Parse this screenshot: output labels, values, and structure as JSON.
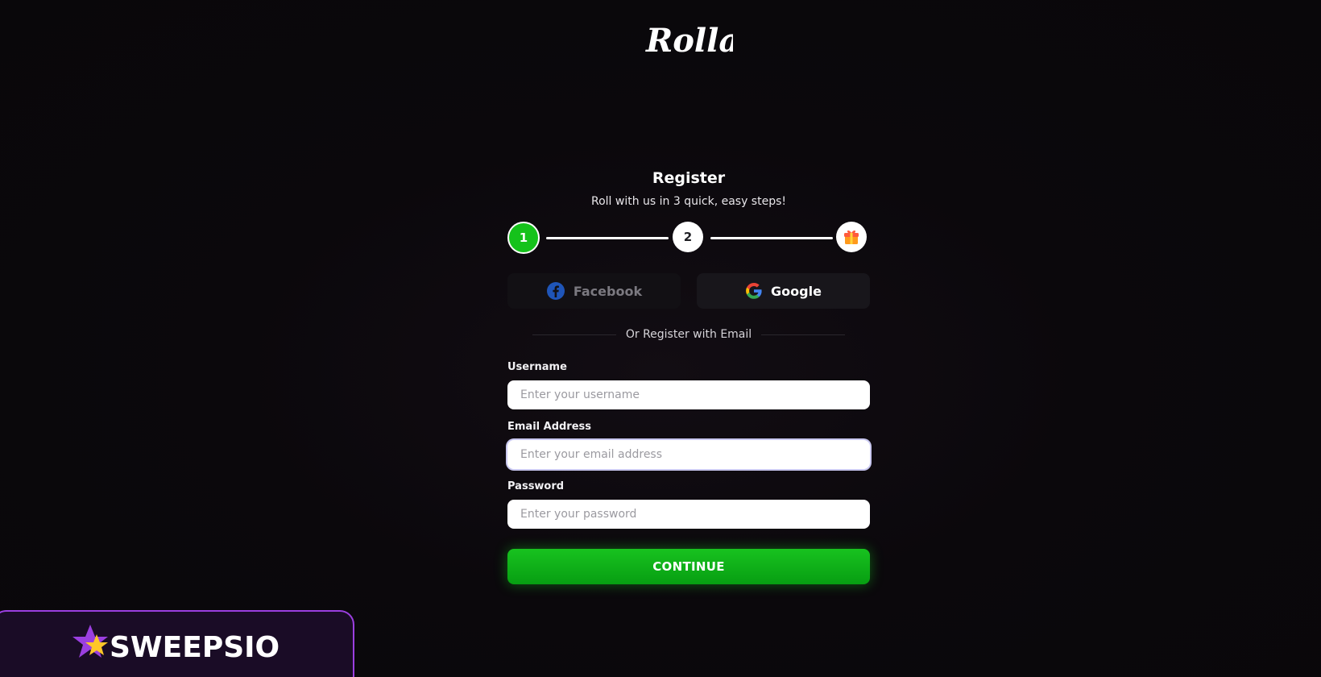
{
  "brand": {
    "logo_text": "Rolla"
  },
  "register": {
    "title": "Register",
    "subtitle": "Roll with us in 3 quick, easy steps!"
  },
  "stepper": {
    "steps": [
      {
        "label": "1",
        "state": "active",
        "color": "#15c21b"
      },
      {
        "label": "2",
        "state": "pending"
      },
      {
        "icon": "gift-icon",
        "state": "pending"
      }
    ]
  },
  "social": {
    "facebook_label": "Facebook",
    "google_label": "Google"
  },
  "divider": {
    "text": "Or Register with Email"
  },
  "form": {
    "username": {
      "label": "Username",
      "placeholder": "Enter your username",
      "value": ""
    },
    "email": {
      "label": "Email Address",
      "placeholder": "Enter your email address",
      "value": ""
    },
    "password": {
      "label": "Password",
      "placeholder": "Enter your password",
      "value": ""
    },
    "continue_label": "CONTINUE"
  },
  "watermark": {
    "text": "SWEEPSIO"
  },
  "colors": {
    "accent_green": "#15c21b",
    "background": "#0a070b",
    "watermark_border": "#9b3fe0"
  }
}
